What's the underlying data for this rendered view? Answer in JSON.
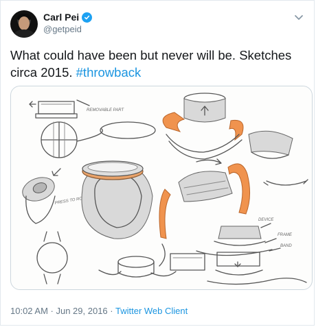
{
  "tweet": {
    "author_name": "Carl Pei",
    "handle": "@getpeid",
    "text": "What could have been but never will be. Sketches circa 2015.",
    "hashtag": "#throwback",
    "timestamp": "10:02 AM · Jun 29, 2016 ·",
    "client": "Twitter Web Client"
  },
  "icons": {
    "avatar": "profile-photo",
    "verified": "verified-badge-icon",
    "more": "chevron-down-icon"
  },
  "sketch_notes": {
    "note_top": "REMOVABLE PART",
    "note_left": "PRESS TO ROTATE BOTTOM CAP",
    "label_device": "DEVICE",
    "label_frame": "FRAME",
    "label_band": "BAND"
  },
  "colors": {
    "accent": "#1da1f2",
    "link": "#1b95e0",
    "band_orange": "#f0934e"
  }
}
